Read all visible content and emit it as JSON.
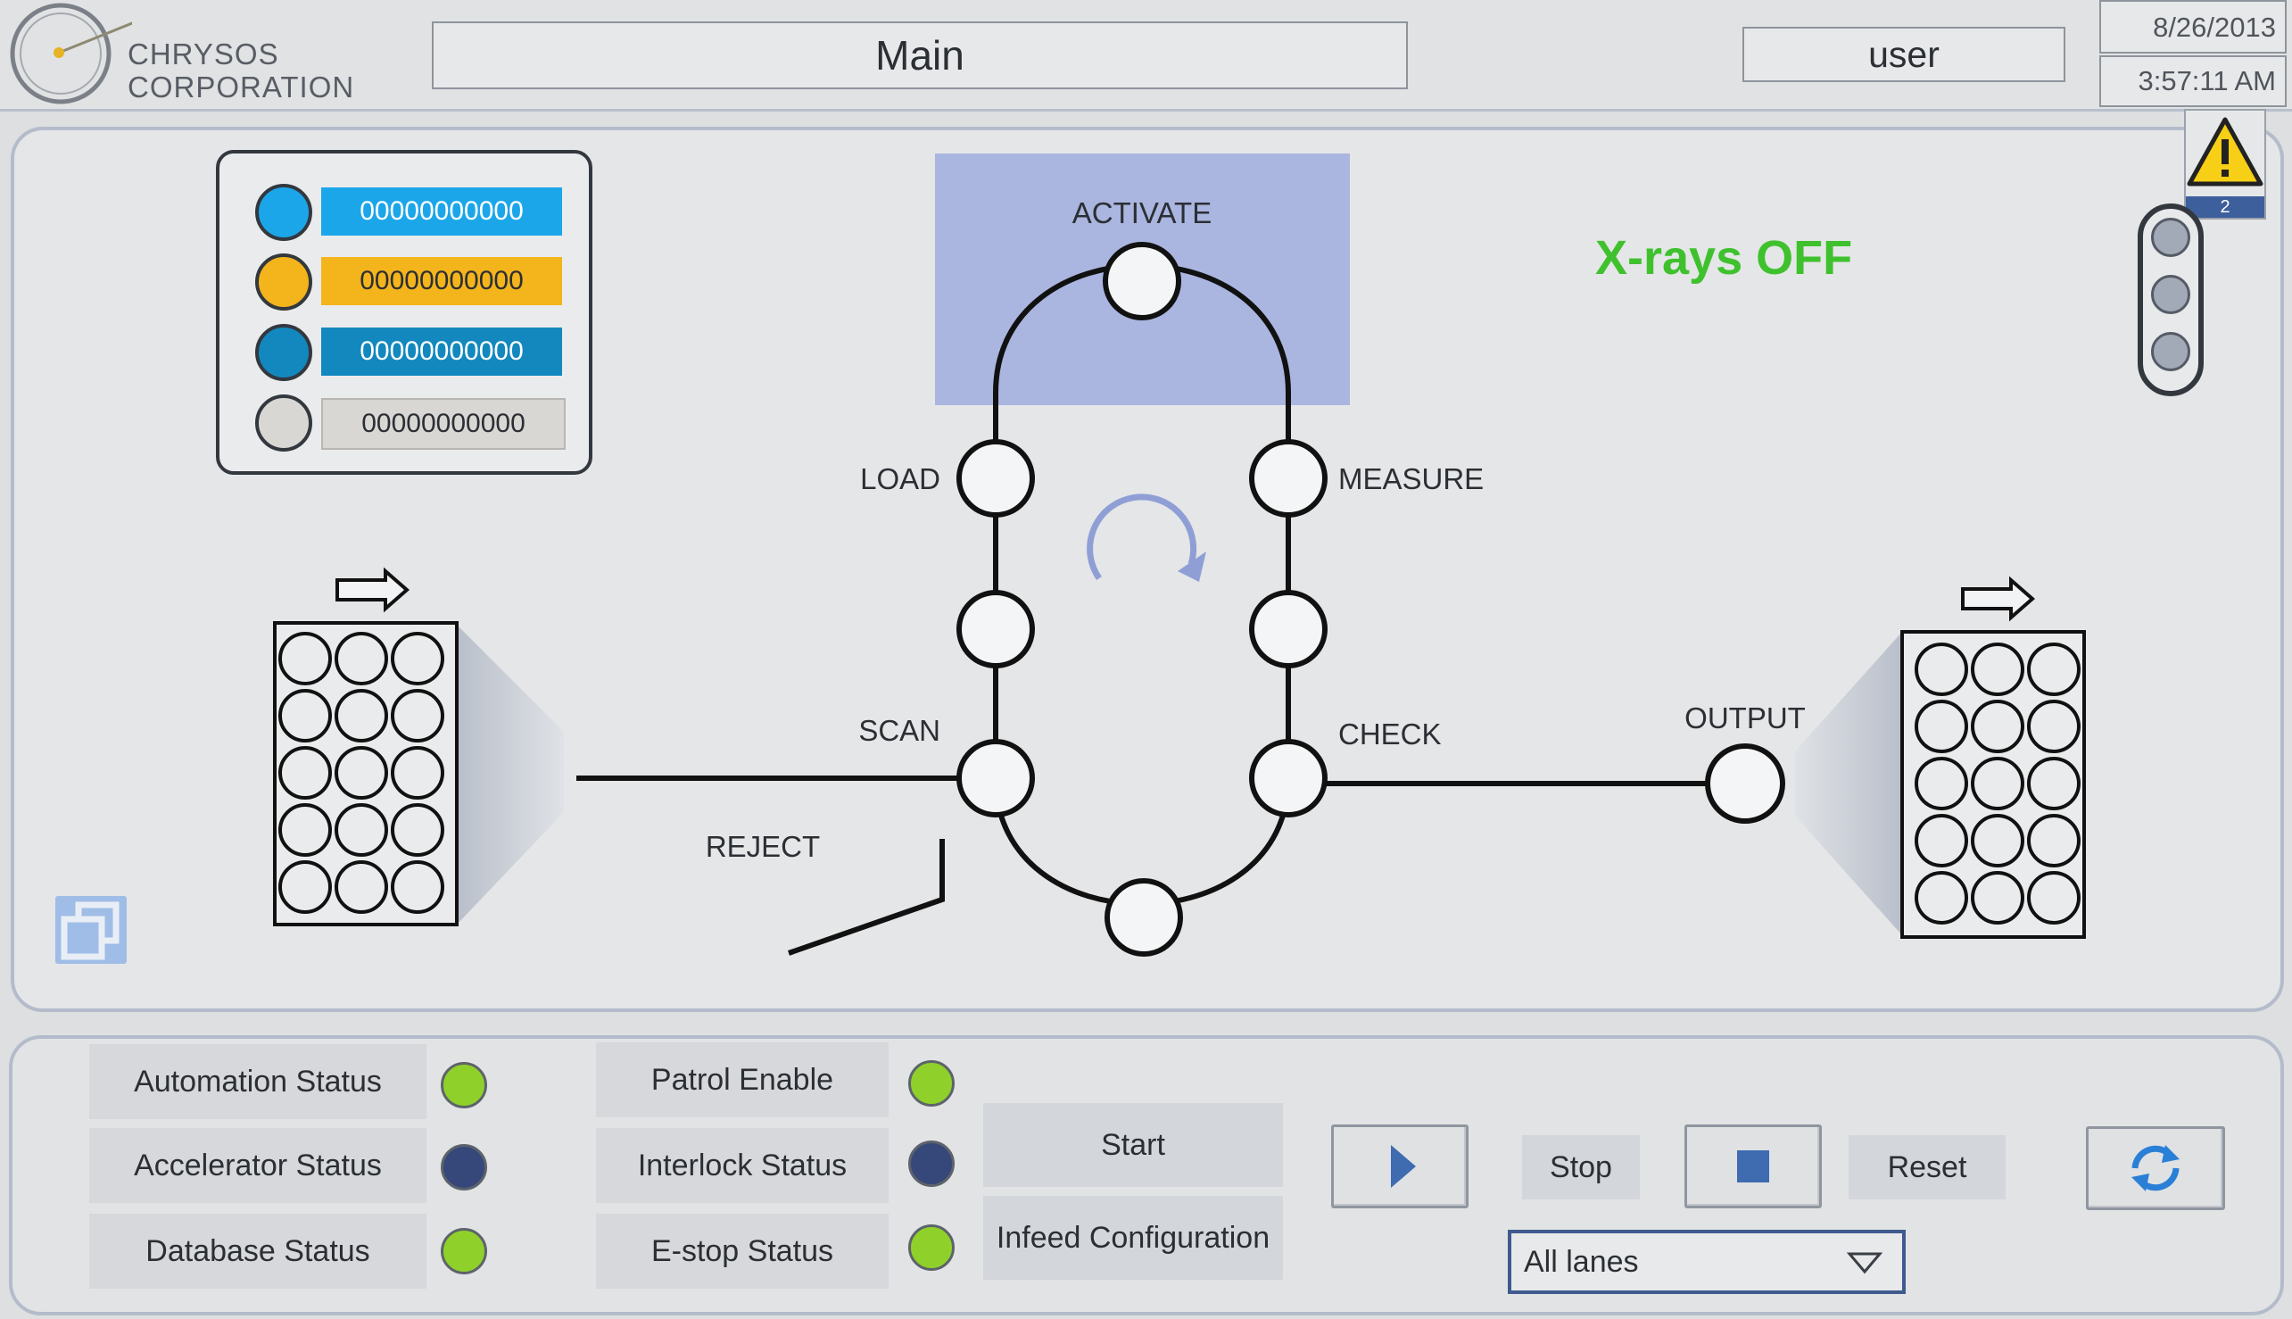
{
  "header": {
    "logo_line1": "CHRYSOS",
    "logo_line2": "CORPORATION",
    "screen_title": "Main",
    "user": "user",
    "date": "8/26/2013",
    "time": "3:57:11 AM"
  },
  "alarms": {
    "count": "2",
    "icon": "warning-icon"
  },
  "lanes": [
    {
      "value": "00000000000",
      "color": "#1ca6ea",
      "text_color": "#ffffff"
    },
    {
      "value": "00000000000",
      "color": "#f4b41b",
      "text_color": "#2b2f34"
    },
    {
      "value": "00000000000",
      "color": "#1288bf",
      "text_color": "#ffffff"
    },
    {
      "value": "00000000000",
      "color": "#d9d7d3",
      "text_color": "#2b2f34"
    }
  ],
  "xray_status": "X-rays OFF",
  "process": {
    "stations": {
      "activate": "ACTIVATE",
      "load": "LOAD",
      "measure": "MEASURE",
      "scan": "SCAN",
      "check": "CHECK",
      "reject": "REJECT",
      "output": "OUTPUT"
    }
  },
  "status": {
    "automation": "Automation Status",
    "accelerator": "Accelerator Status",
    "database": "Database Status",
    "patrol": "Patrol Enable",
    "interlock": "Interlock Status",
    "estop": "E-stop Status"
  },
  "controls": {
    "start": "Start",
    "infeed": "Infeed Configuration",
    "stop": "Stop",
    "reset": "Reset",
    "lanes_select": "All lanes"
  },
  "colors": {
    "accent": "#3f5a8f",
    "xray_off": "#3fc12e",
    "led_green": "#8fd12a",
    "led_navy": "#36477a",
    "activate_zone": "#aab6e0"
  }
}
